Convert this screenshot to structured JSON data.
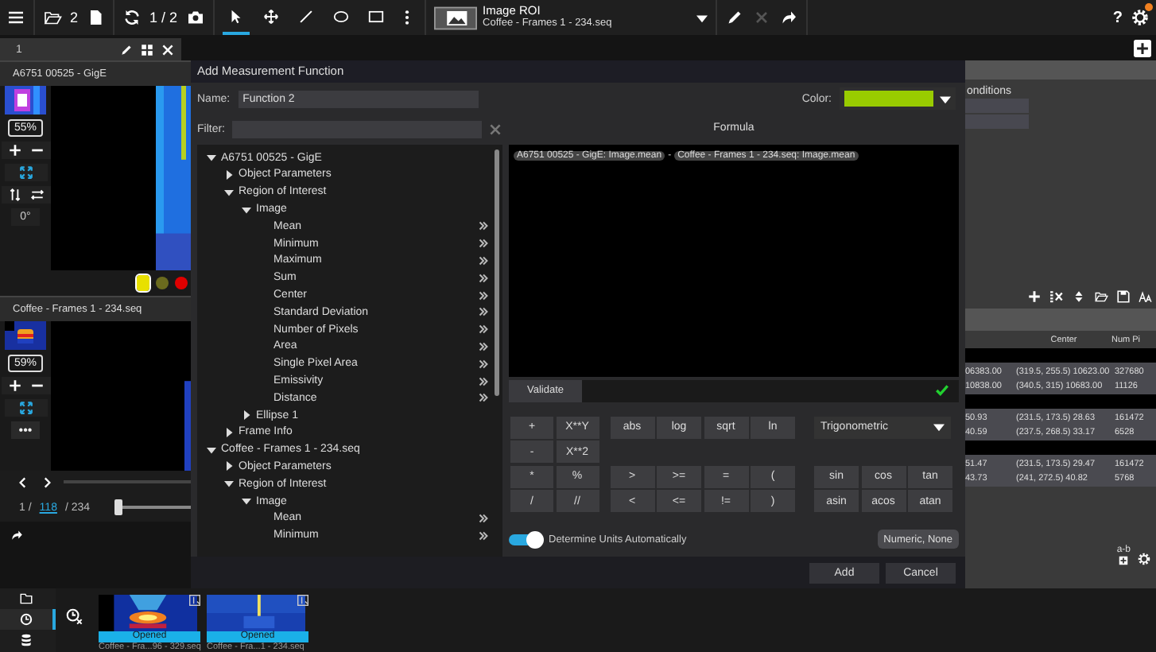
{
  "toolbar": {
    "open_count": "2",
    "frame_counter": "1 / 2",
    "tools": [
      {
        "kind": "pointer",
        "selected": true
      },
      {
        "kind": "move",
        "selected": false
      },
      {
        "kind": "line",
        "selected": false
      },
      {
        "kind": "ellipse",
        "selected": false
      },
      {
        "kind": "rectangle",
        "selected": false
      }
    ],
    "roi_selector": {
      "title": "Image ROI",
      "source": "Coffee - Frames 1 - 234.seq"
    },
    "delete_disabled": true,
    "help": "?",
    "settings_badge": true
  },
  "tab": {
    "label": "1"
  },
  "viewers": [
    {
      "title": "A6751 00525 - GigE",
      "zoom": "55%",
      "rotation": "0°"
    },
    {
      "title": "Coffee - Frames 1 - 234.seq",
      "zoom": "59%",
      "more": "•••"
    }
  ],
  "palette_dots": [
    {
      "color": "#e8e000",
      "selected": true
    },
    {
      "color": "#6b6b1e",
      "selected": false
    },
    {
      "color": "#e00000",
      "selected": false
    }
  ],
  "playback": {
    "current": "1 /",
    "frame": "118",
    "total": "/ 234",
    "level": 0
  },
  "dialog": {
    "title": "Add Measurement Function",
    "name_label": "Name:",
    "name_value": "Function 2",
    "color_label": "Color:",
    "color": "#99cc00",
    "filter_label": "Filter:",
    "tree": [
      {
        "label": "A6751 00525 - GigE",
        "kind": "group",
        "expanded": true,
        "children": [
          {
            "label": "Object Parameters",
            "kind": "group",
            "expanded": false
          },
          {
            "label": "Region of Interest",
            "kind": "group",
            "expanded": true,
            "children": [
              {
                "label": "Image",
                "kind": "group",
                "expanded": true,
                "children": [
                  {
                    "label": "Mean",
                    "kind": "measure"
                  },
                  {
                    "label": "Minimum",
                    "kind": "measure"
                  },
                  {
                    "label": "Maximum",
                    "kind": "measure"
                  },
                  {
                    "label": "Sum",
                    "kind": "measure"
                  },
                  {
                    "label": "Center",
                    "kind": "measure"
                  },
                  {
                    "label": "Standard Deviation",
                    "kind": "measure"
                  },
                  {
                    "label": "Number of Pixels",
                    "kind": "measure"
                  },
                  {
                    "label": "Area",
                    "kind": "measure"
                  },
                  {
                    "label": "Single Pixel Area",
                    "kind": "measure"
                  },
                  {
                    "label": "Emissivity",
                    "kind": "measure"
                  },
                  {
                    "label": "Distance",
                    "kind": "measure"
                  }
                ]
              },
              {
                "label": "Ellipse 1",
                "kind": "group",
                "expanded": false
              }
            ]
          },
          {
            "label": "Frame Info",
            "kind": "group",
            "expanded": false
          }
        ]
      },
      {
        "label": "Coffee - Frames 1 - 234.seq",
        "kind": "group",
        "expanded": true,
        "children": [
          {
            "label": "Object Parameters",
            "kind": "group",
            "expanded": false
          },
          {
            "label": "Region of Interest",
            "kind": "group",
            "expanded": true,
            "children": [
              {
                "label": "Image",
                "kind": "group",
                "expanded": true,
                "children": [
                  {
                    "label": "Mean",
                    "kind": "measure"
                  },
                  {
                    "label": "Minimum",
                    "kind": "measure"
                  }
                ]
              }
            ]
          }
        ]
      }
    ],
    "formula_title": "Formula",
    "formula_tokens": [
      {
        "kind": "reference",
        "text": "A6751 00525 - GigE: Image.mean"
      },
      {
        "kind": "operator",
        "text": "-"
      },
      {
        "kind": "reference",
        "text": "Coffee - Frames 1 - 234.seq: Image.mean"
      }
    ],
    "validate": "Validate",
    "valid": true,
    "operators": [
      "+",
      "X**Y",
      "-",
      "X**2",
      "*",
      "%",
      "/",
      "//"
    ],
    "functions": [
      "abs",
      "log",
      "sqrt",
      "ln"
    ],
    "comparisons": [
      ">",
      ">=",
      "=",
      "(",
      "<",
      "<=",
      "!=",
      ")"
    ],
    "function_group": "Trigonometric",
    "trig_functions": [
      "sin",
      "cos",
      "tan",
      "asin",
      "acos",
      "atan"
    ],
    "auto_units": {
      "label": "Determine Units Automatically",
      "on": true
    },
    "unit_button": "Numeric, None",
    "buttons": [
      "Add",
      "Cancel"
    ]
  },
  "right_panel": {
    "heading": "onditions",
    "columns": [
      "Center",
      "Num Pi"
    ],
    "groups": [
      [
        [
          "06383.00",
          "(319.5, 255.5) 10623.00",
          "327680"
        ],
        [
          "10838.00",
          "(340.5, 315) 10683.00",
          "11126"
        ]
      ],
      [
        [
          "50.93",
          "(231.5, 173.5) 28.63",
          "161472"
        ],
        [
          "40.59",
          "(237.5, 268.5) 33.17",
          "6528"
        ]
      ],
      [
        [
          "51.47",
          "(231.5, 173.5) 29.47",
          "161472"
        ],
        [
          "43.73",
          "(241, 272.5) 40.82",
          "5768"
        ]
      ]
    ],
    "diff_label": "a-b"
  },
  "sidebar": [
    {
      "kind": "folder",
      "selected": false
    },
    {
      "kind": "history",
      "selected": true
    },
    {
      "kind": "database",
      "selected": false
    }
  ],
  "recent": [
    {
      "status": "Opened",
      "caption": "Coffee - Fra...96 - 329.seq"
    },
    {
      "status": "Opened",
      "caption": "Coffee - Fra...1 - 234.seq"
    }
  ]
}
